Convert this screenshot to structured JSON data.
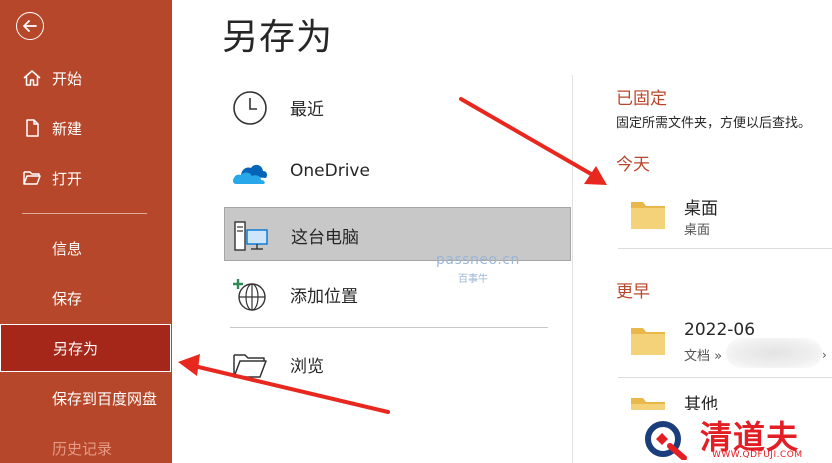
{
  "page_title": "另存为",
  "nav": {
    "items": [
      {
        "label": "开始",
        "icon": "home-icon"
      },
      {
        "label": "新建",
        "icon": "new-file-icon"
      },
      {
        "label": "打开",
        "icon": "open-folder-icon"
      },
      {
        "label": "信息"
      },
      {
        "label": "保存"
      },
      {
        "label": "另存为",
        "selected": true
      },
      {
        "label": "保存到百度网盘"
      },
      {
        "label": "历史记录",
        "disabled": true
      }
    ]
  },
  "locations": [
    {
      "label": "最近",
      "icon": "clock-icon"
    },
    {
      "label": "OneDrive",
      "icon": "onedrive-cloud-icon"
    },
    {
      "label": "这台电脑",
      "icon": "this-pc-icon",
      "selected": true
    },
    {
      "label": "添加位置",
      "icon": "add-location-globe-icon"
    },
    {
      "label": "浏览",
      "icon": "browse-folder-icon"
    }
  ],
  "right": {
    "pinned_title": "已固定",
    "pinned_desc": "固定所需文件夹，方便以后查找。",
    "today_title": "今天",
    "earlier_title": "更早",
    "folders_today": [
      {
        "name": "桌面",
        "path": "桌面"
      }
    ],
    "folders_earlier": [
      {
        "name": "2022-06",
        "path": "文档 »"
      },
      {
        "name": "其他",
        "path": ""
      }
    ]
  },
  "watermark": {
    "text": "passneo.cn",
    "sub": "百事牛"
  },
  "logo": {
    "name": "清道夫",
    "url": "WWW.QDFUJI.COM"
  },
  "colors": {
    "accent": "#b7472a",
    "selected_nav": "#a4271a",
    "arrow": "#e8281e",
    "folder": "#f0c96b"
  }
}
